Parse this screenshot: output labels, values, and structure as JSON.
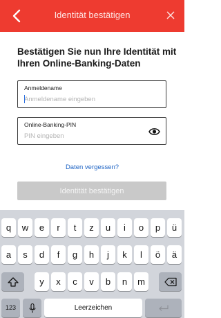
{
  "header": {
    "title": "Identität bestätigen",
    "background": "#ee3b30",
    "back_icon": "chevron-left-icon",
    "close_icon": "close-icon"
  },
  "heading": "Bestätigen Sie nun Ihre Identität mit Ihren Online-Banking-Daten",
  "form": {
    "username": {
      "label": "Anmeldename",
      "placeholder": "Anmeldename eingeben",
      "value": ""
    },
    "pin": {
      "label": "Online-Banking-PIN",
      "placeholder": "PIN eingeben",
      "value": "",
      "toggle_icon": "eye-icon"
    },
    "forgot_link": "Daten vergessen?",
    "submit_label": "Identität bestätigen",
    "link_color": "#1d63c4"
  },
  "keyboard": {
    "row1": [
      "q",
      "w",
      "e",
      "r",
      "t",
      "z",
      "u",
      "i",
      "o",
      "p",
      "ü"
    ],
    "row2": [
      "a",
      "s",
      "d",
      "f",
      "g",
      "h",
      "j",
      "k",
      "l",
      "ö",
      "ä"
    ],
    "row3": [
      "y",
      "x",
      "c",
      "v",
      "b",
      "n",
      "m"
    ],
    "shift_icon": "shift-icon",
    "backspace_icon": "backspace-icon",
    "numbers_label": "123",
    "mic_icon": "microphone-icon",
    "space_label": "Leerzeichen",
    "return_icon": "return-icon"
  }
}
